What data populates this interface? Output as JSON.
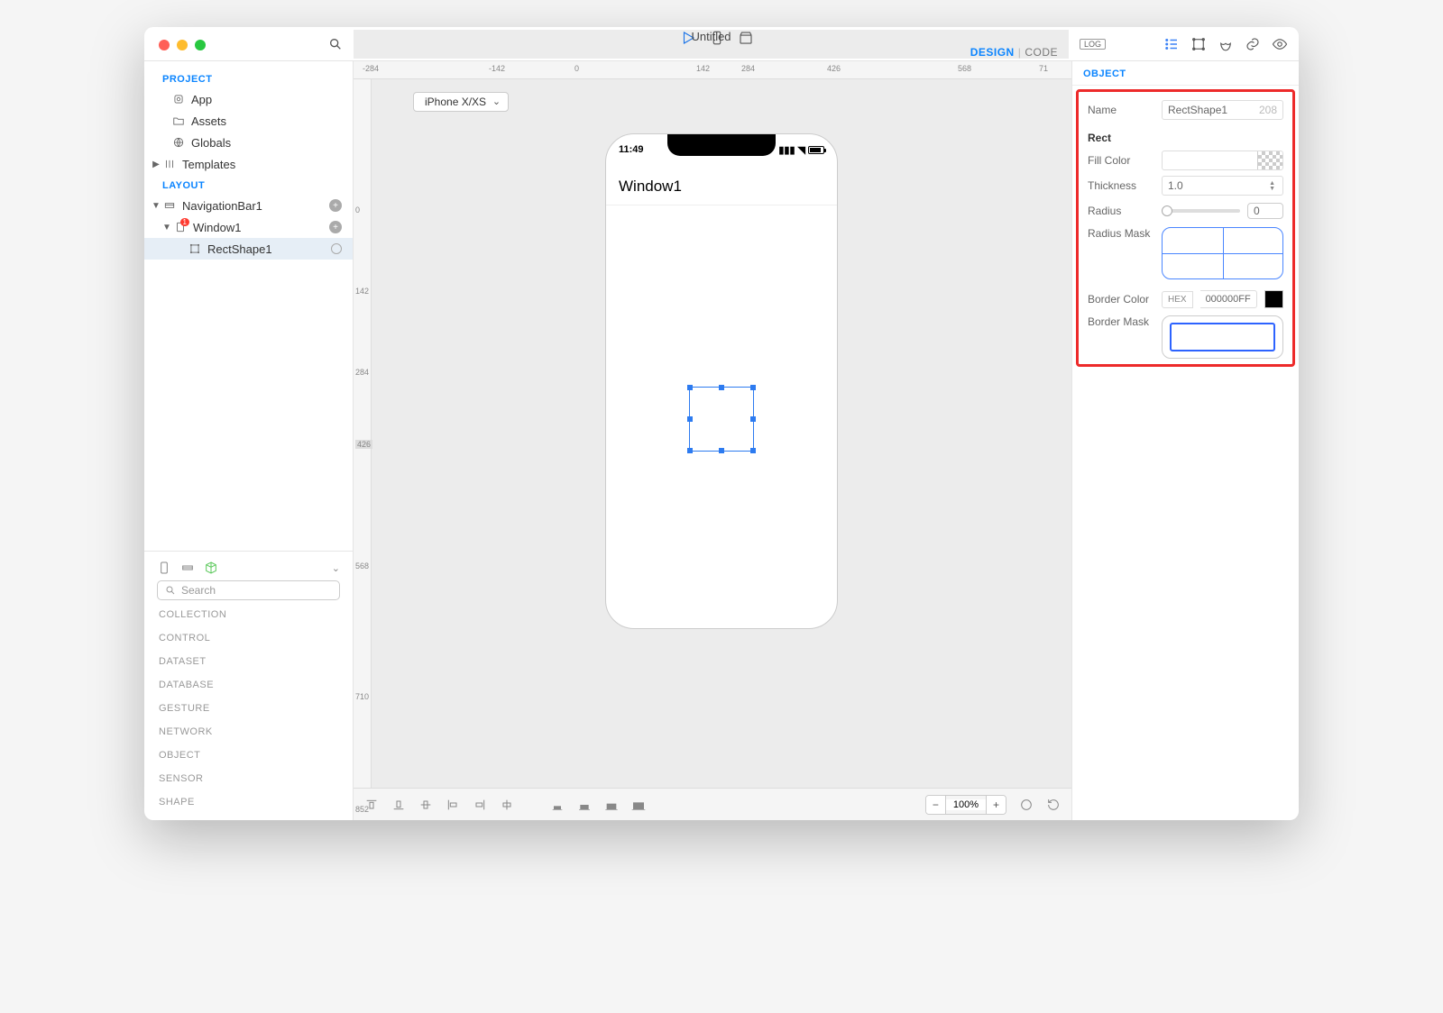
{
  "title": "Untitled",
  "mode": {
    "design": "DESIGN",
    "code": "CODE"
  },
  "log": "LOG",
  "left": {
    "project_label": "PROJECT",
    "layout_label": "LAYOUT",
    "items": {
      "app": "App",
      "assets": "Assets",
      "globals": "Globals",
      "templates": "Templates"
    },
    "tree": {
      "nav": "NavigationBar1",
      "window": "Window1",
      "rect": "RectShape1"
    }
  },
  "library": {
    "search_placeholder": "Search",
    "cats": [
      "COLLECTION",
      "CONTROL",
      "DATASET",
      "DATABASE",
      "GESTURE",
      "NETWORK",
      "OBJECT",
      "SENSOR",
      "SHAPE"
    ]
  },
  "device": "iPhone X/XS",
  "canvas": {
    "time": "11:49",
    "window_title": "Window1",
    "ruler_h": [
      "-284",
      "-142",
      "0",
      "142",
      "284",
      "426",
      "568",
      "71"
    ],
    "ruler_v": [
      "0",
      "142",
      "284",
      "426",
      "568",
      "710",
      "852"
    ]
  },
  "zoom": "100%",
  "inspector": {
    "tab": "OBJECT",
    "name_label": "Name",
    "name_value": "RectShape1",
    "name_sub": "208",
    "section": "Rect",
    "fill": "Fill Color",
    "thickness_label": "Thickness",
    "thickness_value": "1.0",
    "radius_label": "Radius",
    "radius_value": "0",
    "radius_mask": "Radius Mask",
    "border_color": "Border Color",
    "hex_label": "HEX",
    "hex_value": "000000FF",
    "border_mask": "Border Mask"
  }
}
